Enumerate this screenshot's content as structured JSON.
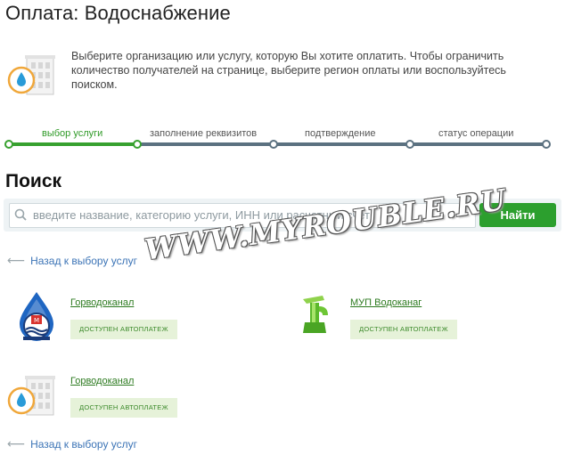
{
  "page": {
    "title": "Оплата: Водоснабжение"
  },
  "intro": {
    "text": "Выберите организацию или услугу, которую Вы хотите оплатить. Чтобы ограничить количество получателей на странице, выберите регион оплаты или воспользуйтесь поиском."
  },
  "steps": [
    {
      "label": "выбор услуги",
      "state": "active"
    },
    {
      "label": "заполнение реквизитов",
      "state": "pending"
    },
    {
      "label": "подтверждение",
      "state": "pending"
    },
    {
      "label": "статус операции",
      "state": "pending"
    }
  ],
  "search": {
    "title": "Поиск",
    "placeholder": "введите название, категорию услуги, ИНН или расчетный счет",
    "button": "Найти"
  },
  "back_link": "Назад к выбору услуг",
  "providers": [
    {
      "name": "Горводоканал",
      "badge": "ДОСТУПЕН АВТОПЛАТЕЖ",
      "icon": "gorvodokanal-logo"
    },
    {
      "name": "МУП Водоканаг",
      "badge": "ДОСТУПЕН АВТОПЛАТЕЖ",
      "icon": "water-faucet-icon"
    },
    {
      "name": "Горводоканал",
      "badge": "ДОСТУПЕН АВТОПЛАТЕЖ",
      "icon": "building-water-drop-icon"
    }
  ],
  "watermark": "WWW.MYROUBLE.RU",
  "colors": {
    "accent_green": "#2c9f2e",
    "track": "#5b7180",
    "link_blue": "#3c74b6",
    "drop_blue": "#2a9bd8"
  }
}
